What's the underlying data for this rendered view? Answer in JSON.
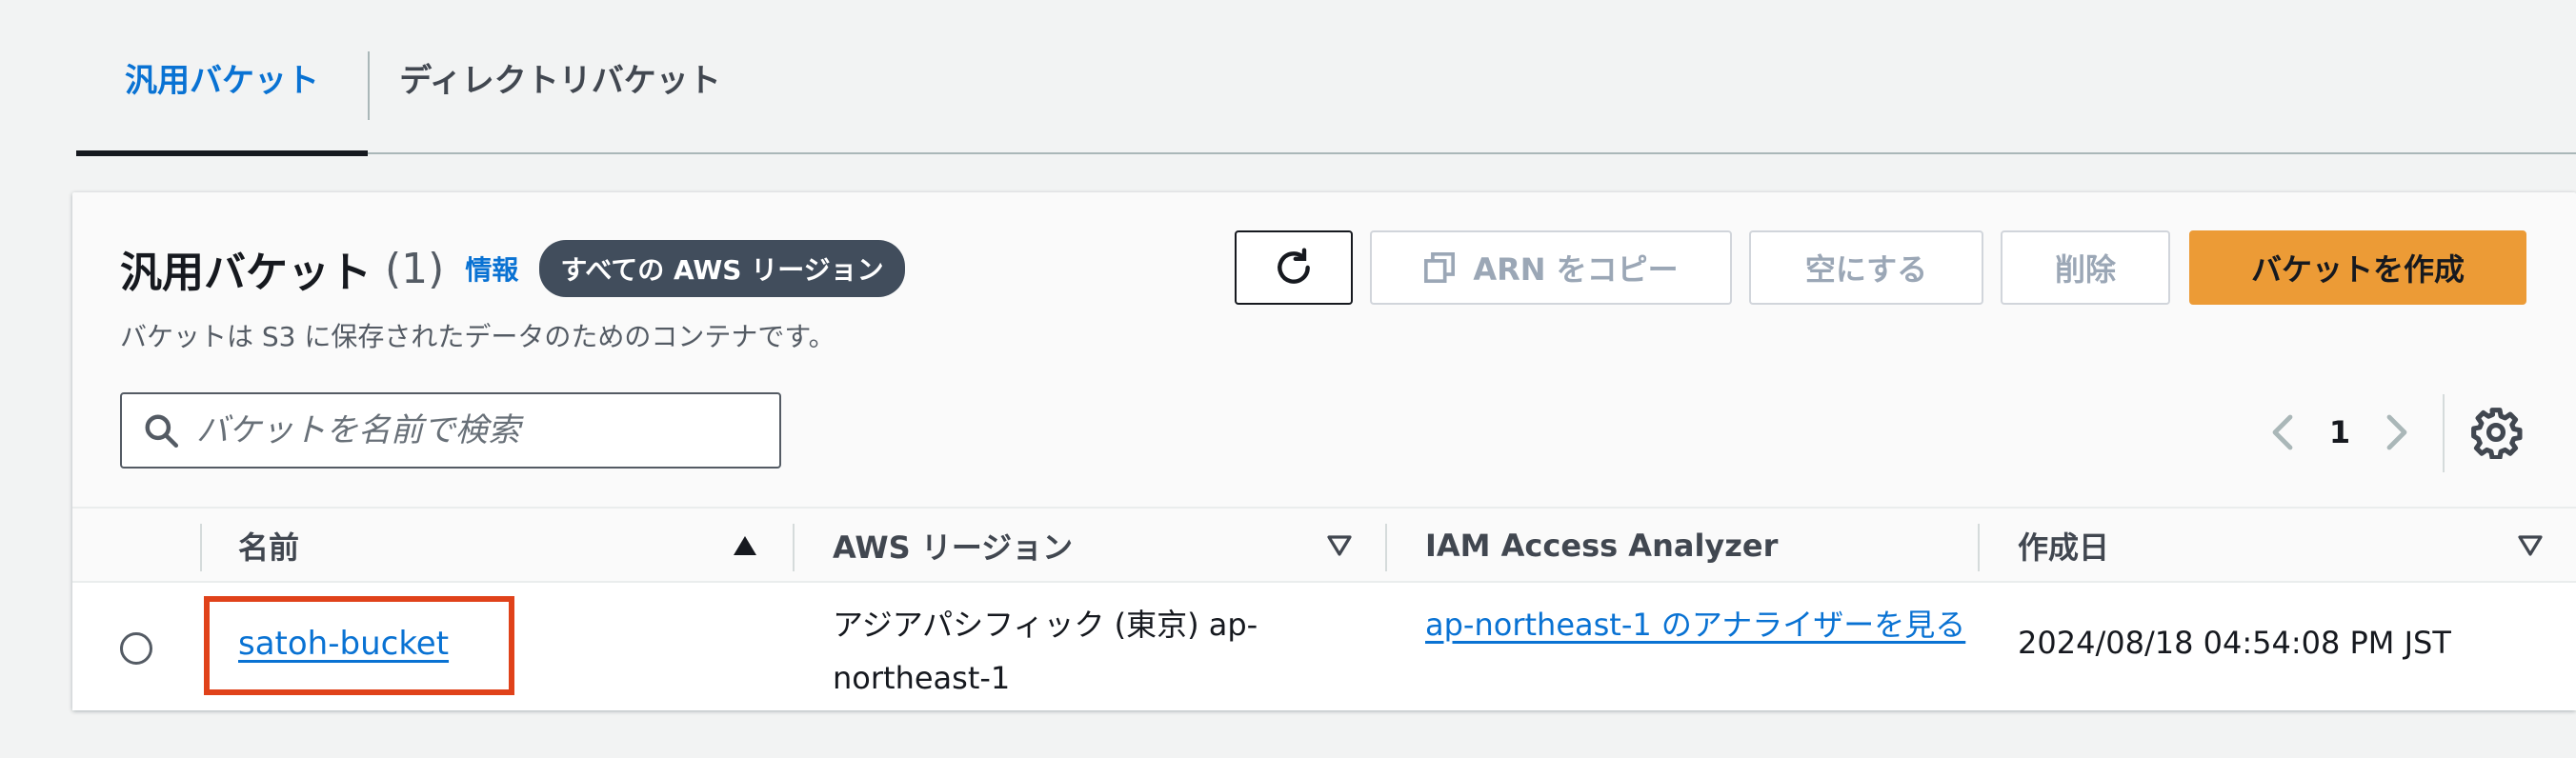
{
  "tabs": [
    {
      "label": "汎用バケット",
      "active": true
    },
    {
      "label": "ディレクトリバケット",
      "active": false
    }
  ],
  "panel": {
    "title": "汎用バケット",
    "count": "(1)",
    "info_link": "情報",
    "region_badge": "すべての AWS リージョン",
    "description": "バケットは S3 に保存されたデータのためのコンテナです。"
  },
  "toolbar": {
    "refresh_icon": "refresh-icon",
    "copy_arn_label": "ARN をコピー",
    "empty_label": "空にする",
    "delete_label": "削除",
    "create_label": "バケットを作成"
  },
  "search": {
    "placeholder": "バケットを名前で検索",
    "value": ""
  },
  "pagination": {
    "current_page": "1"
  },
  "table": {
    "columns": [
      {
        "label": "名前",
        "sort": "ascending"
      },
      {
        "label": "AWS リージョン",
        "sort": "none"
      },
      {
        "label": "IAM Access Analyzer",
        "sort": null
      },
      {
        "label": "作成日",
        "sort": "none"
      }
    ],
    "rows": [
      {
        "name": "satoh-bucket",
        "region": "アジアパシフィック (東京) ap-northeast-1",
        "access_analyzer": "ap-northeast-1 のアナライザーを見る",
        "created": "2024/08/18 04:54:08 PM JST",
        "highlighted": true
      }
    ]
  },
  "colors": {
    "accent_blue": "#0972d3",
    "primary_orange": "#ec9b36",
    "highlight_red": "#e0421a"
  }
}
